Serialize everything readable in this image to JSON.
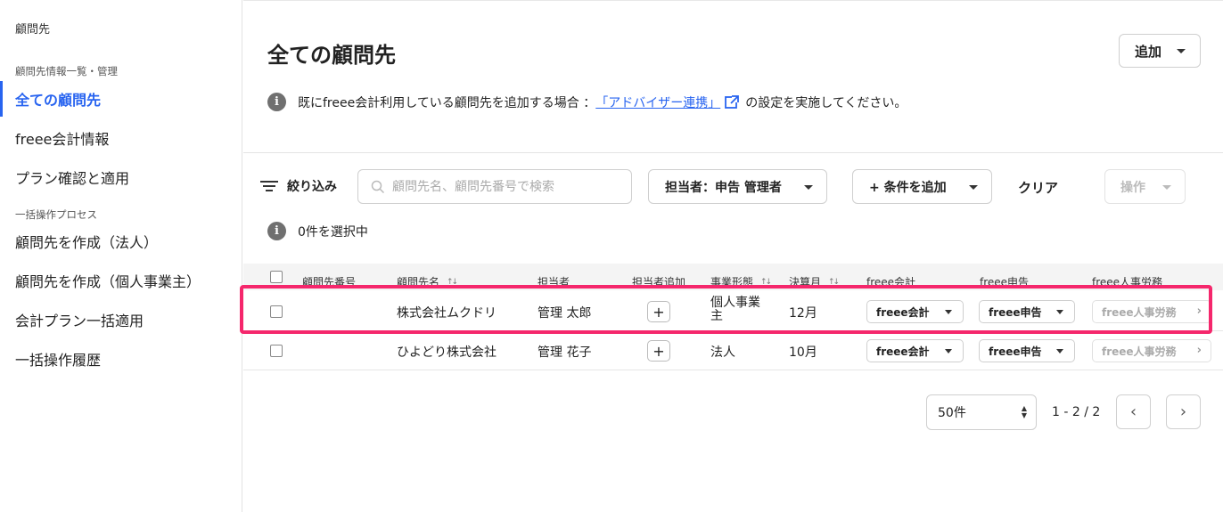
{
  "sidebar": {
    "header": "顧問先",
    "section1": "顧問先情報一覧・管理",
    "items1": [
      {
        "label": "全ての顧問先"
      },
      {
        "label": "freee会計情報"
      },
      {
        "label": "プラン確認と適用"
      }
    ],
    "section2": "一括操作プロセス",
    "items2": [
      {
        "label": "顧問先を作成（法人）"
      },
      {
        "label": "顧問先を作成（個人事業主）"
      },
      {
        "label": "会計プラン一括適用"
      },
      {
        "label": "一括操作履歴"
      }
    ]
  },
  "header": {
    "title": "全ての顧問先",
    "add_label": "追加"
  },
  "info": {
    "prefix": "既にfreee会計利用している顧問先を追加する場合 ：",
    "link": "「アドバイザー連携」",
    "suffix": "の設定を実施してください。"
  },
  "filter": {
    "label": "絞り込み",
    "search_placeholder": "顧問先名、顧問先番号で検索",
    "assignee_filter": "担当者：申告 管理者",
    "add_condition": "+ 条件を追加",
    "clear": "クリア",
    "operation": "操作"
  },
  "selection": {
    "text": "0件を選択中"
  },
  "table": {
    "headers": {
      "number": "顧問先番号",
      "name": "顧問先名",
      "assignee": "担当者",
      "add_assignee": "担当者追加",
      "business_type": "事業形態",
      "fiscal_month": "決算月",
      "accounting": "freee会計",
      "tax": "freee申告",
      "hr": "freee人事労務"
    },
    "rows": [
      {
        "number": "",
        "name": "株式会社ムクドリ",
        "assignee": "管理 太郎",
        "add": "+",
        "business_type": "個人事業主",
        "fiscal_month": "12月",
        "accounting": "freee会計",
        "tax": "freee申告",
        "hr": "freee人事労務"
      },
      {
        "number": "",
        "name": "ひよどり株式会社",
        "assignee": "管理 花子",
        "add": "+",
        "business_type": "法人",
        "fiscal_month": "10月",
        "accounting": "freee会計",
        "tax": "freee申告",
        "hr": "freee人事労務"
      }
    ]
  },
  "pagination": {
    "per_page": "50件",
    "range": "1 - 2 / 2"
  },
  "colors": {
    "accent": "#2864f0",
    "highlight": "#f5276c"
  }
}
